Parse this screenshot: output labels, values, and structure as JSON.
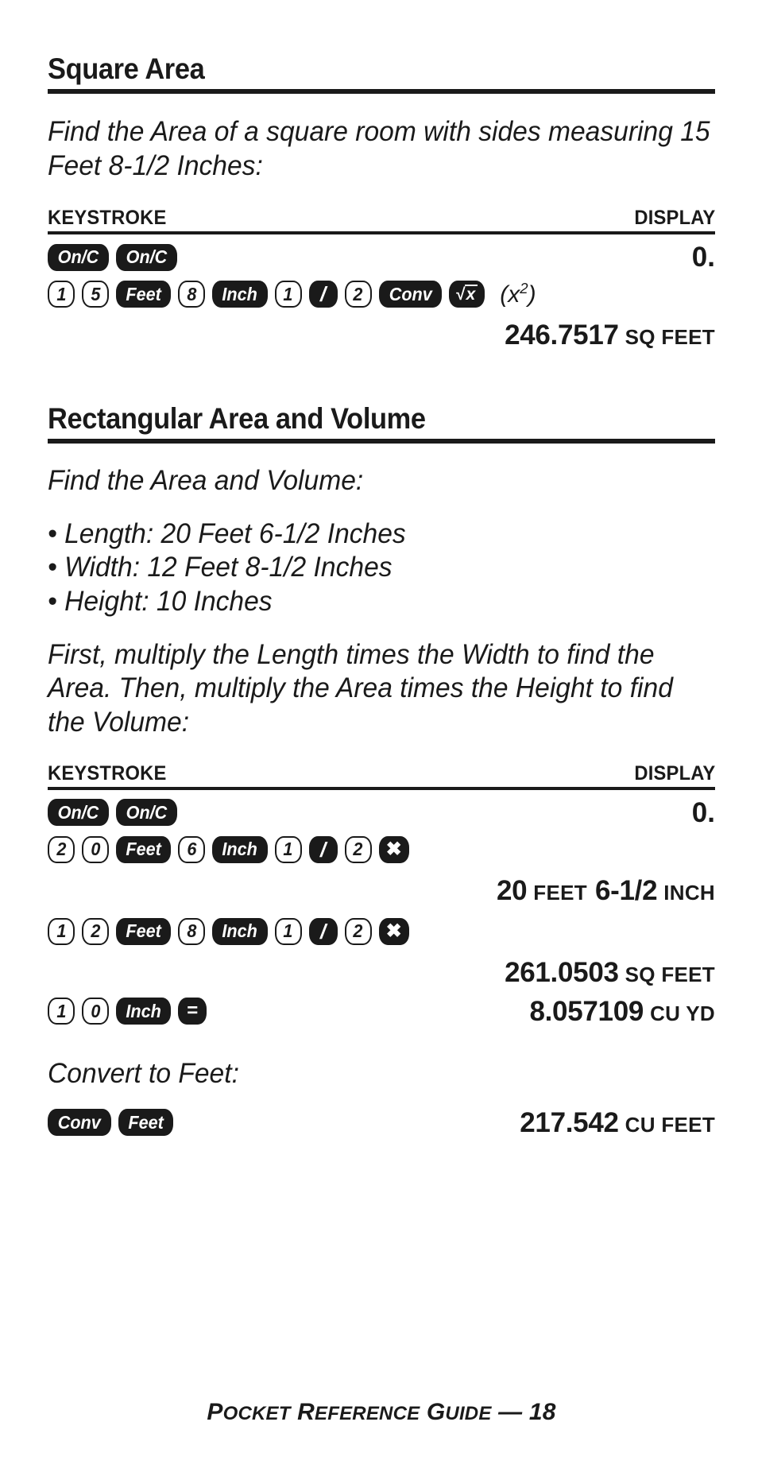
{
  "sections": [
    {
      "heading": "Square Area",
      "intro": "Find the Area of a square room with sides measuring 15 Feet 8-1/2 Inches:",
      "table": {
        "col_keystroke": "KEYSTROKE",
        "col_display": "DISPLAY"
      },
      "rows": [
        {
          "keys": [
            {
              "label": "On/C",
              "style": "dark"
            },
            {
              "label": "On/C",
              "style": "dark"
            }
          ],
          "display_value": "0.",
          "display_unit": ""
        },
        {
          "keys": [
            {
              "label": "1",
              "style": "light"
            },
            {
              "label": "5",
              "style": "light"
            },
            {
              "label": "Feet",
              "style": "dark"
            },
            {
              "label": "8",
              "style": "light"
            },
            {
              "label": "Inch",
              "style": "dark"
            },
            {
              "label": "1",
              "style": "light"
            },
            {
              "label": "/",
              "style": "dark",
              "glyph": "slash"
            },
            {
              "label": "2",
              "style": "light"
            },
            {
              "label": "Conv",
              "style": "dark"
            },
            {
              "label": "sqrt-x",
              "style": "dark",
              "glyph": "radical"
            }
          ],
          "annotation": "(x2)",
          "display_value": "",
          "display_unit": ""
        },
        {
          "keys": [],
          "display_value": "246.7517",
          "display_unit": "SQ FEET"
        }
      ]
    },
    {
      "heading": "Rectangular Area and Volume",
      "intro": "Find the Area and Volume:",
      "bullets": [
        "• Length: 20 Feet 6-1/2 Inches",
        "• Width: 12 Feet 8-1/2 Inches",
        "• Height: 10 Inches"
      ],
      "paragraph": "First, multiply the Length times the Width to find the Area.  Then, multiply the Area times the Height to find the Volume:",
      "table": {
        "col_keystroke": "KEYSTROKE",
        "col_display": "DISPLAY"
      },
      "rows": [
        {
          "keys": [
            {
              "label": "On/C",
              "style": "dark"
            },
            {
              "label": "On/C",
              "style": "dark"
            }
          ],
          "display_value": "0.",
          "display_unit": ""
        },
        {
          "keys": [
            {
              "label": "2",
              "style": "light"
            },
            {
              "label": "0",
              "style": "light"
            },
            {
              "label": "Feet",
              "style": "dark"
            },
            {
              "label": "6",
              "style": "light"
            },
            {
              "label": "Inch",
              "style": "dark"
            },
            {
              "label": "1",
              "style": "light"
            },
            {
              "label": "/",
              "style": "dark",
              "glyph": "slash"
            },
            {
              "label": "2",
              "style": "light"
            },
            {
              "label": "x",
              "style": "dark",
              "glyph": "times"
            }
          ],
          "display_value": "",
          "display_unit": ""
        },
        {
          "keys": [],
          "display_segments": [
            {
              "num": "20",
              "unit": "FEET"
            },
            {
              "num": "6-1/2",
              "unit": "INCH"
            }
          ]
        },
        {
          "keys": [
            {
              "label": "1",
              "style": "light"
            },
            {
              "label": "2",
              "style": "light"
            },
            {
              "label": "Feet",
              "style": "dark"
            },
            {
              "label": "8",
              "style": "light"
            },
            {
              "label": "Inch",
              "style": "dark"
            },
            {
              "label": "1",
              "style": "light"
            },
            {
              "label": "/",
              "style": "dark",
              "glyph": "slash"
            },
            {
              "label": "2",
              "style": "light"
            },
            {
              "label": "x",
              "style": "dark",
              "glyph": "times"
            }
          ],
          "display_value": "",
          "display_unit": ""
        },
        {
          "keys": [],
          "display_value": "261.0503",
          "display_unit": "SQ FEET"
        },
        {
          "keys": [
            {
              "label": "1",
              "style": "light"
            },
            {
              "label": "0",
              "style": "light"
            },
            {
              "label": "Inch",
              "style": "dark"
            },
            {
              "label": "=",
              "style": "dark",
              "glyph": "equals"
            }
          ],
          "display_value": "8.057109",
          "display_unit": "CU YD"
        }
      ],
      "convert_note": "Convert to Feet:",
      "convert_row": {
        "keys": [
          {
            "label": "Conv",
            "style": "dark"
          },
          {
            "label": "Feet",
            "style": "dark"
          }
        ],
        "display_value": "217.542",
        "display_unit": "CU FEET"
      }
    }
  ],
  "footer": {
    "p1_big": "P",
    "p1_small": "OCKET",
    "p2_big": "R",
    "p2_small": "EFERENCE",
    "p3_big": "G",
    "p3_small": "UIDE",
    "dash_page": "— 18"
  },
  "colors": {
    "ink": "#1a1a1a",
    "paper": "#ffffff"
  }
}
